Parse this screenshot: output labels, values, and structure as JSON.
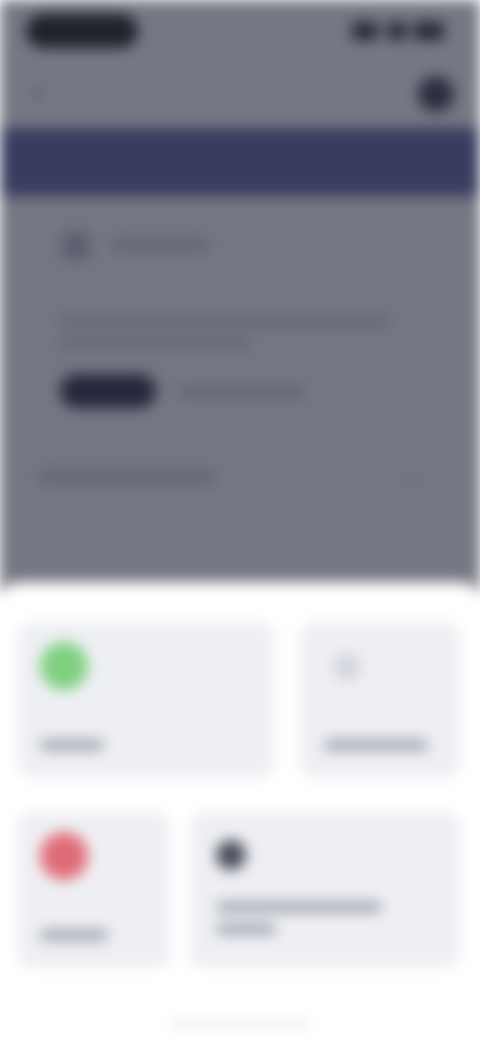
{
  "status_bar": {
    "signal_icon": "signal-icon",
    "wifi_icon": "wifi-icon",
    "battery_icon": "battery-icon"
  },
  "nav_bar": {
    "back_icon": "chevron-left-icon",
    "menu_icon": "more-icon"
  },
  "content": {
    "row_icon": "document-icon",
    "dropdown_icon": "chevron-down-icon"
  },
  "bottom_sheet": {
    "tiles": [
      {
        "icon": "check-circle-icon",
        "color": "#7fd07f"
      },
      {
        "icon": "info-icon",
        "color": "#d1d3db"
      },
      {
        "icon": "close-circle-icon",
        "color": "#e06b78"
      },
      {
        "icon": "gear-icon",
        "color": "#4a4d5a"
      }
    ]
  },
  "colors": {
    "banner": "#525b99",
    "overlay": "#282c3c",
    "sheet": "#ffffff",
    "tile": "#eeeff3"
  }
}
